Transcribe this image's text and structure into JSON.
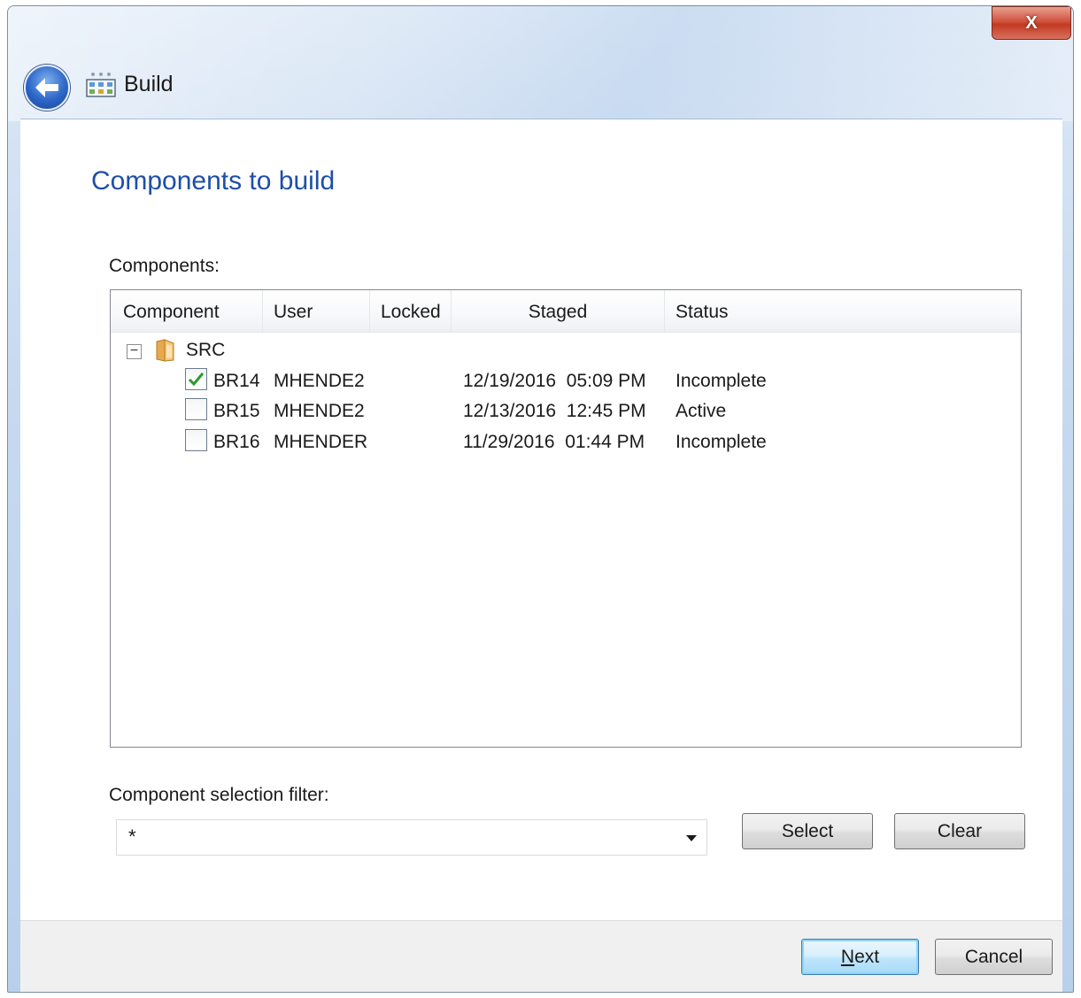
{
  "window": {
    "title": "Build",
    "close_label": "X"
  },
  "page": {
    "heading": "Components to build",
    "components_label": "Components:"
  },
  "listview": {
    "columns": [
      "Component",
      "User",
      "Locked",
      "Staged",
      "Status"
    ],
    "group": "SRC",
    "toggle_glyph": "−",
    "rows": [
      {
        "checked": true,
        "component": "BR14",
        "user": "MHENDE2",
        "locked": "",
        "staged": "12/19/2016  05:09 PM",
        "status": "Incomplete"
      },
      {
        "checked": false,
        "component": "BR15",
        "user": "MHENDE2",
        "locked": "",
        "staged": "12/13/2016  12:45 PM",
        "status": "Active"
      },
      {
        "checked": false,
        "component": "BR16",
        "user": "MHENDER",
        "locked": "",
        "staged": "11/29/2016  01:44 PM",
        "status": "Incomplete"
      }
    ]
  },
  "filter": {
    "label": "Component selection filter:",
    "value": "*"
  },
  "buttons": {
    "select": "Select",
    "clear": "Clear",
    "next_mnemonic": "N",
    "next_rest": "ext",
    "cancel": "Cancel"
  },
  "icons": {
    "back": "back-arrow-icon",
    "app": "build-icon",
    "folder": "folder-icon",
    "dropdown": "chevron-down-icon"
  },
  "colors": {
    "heading": "#1e4fa5",
    "check": "#2e9a2e",
    "close_button": "#c23a22"
  }
}
